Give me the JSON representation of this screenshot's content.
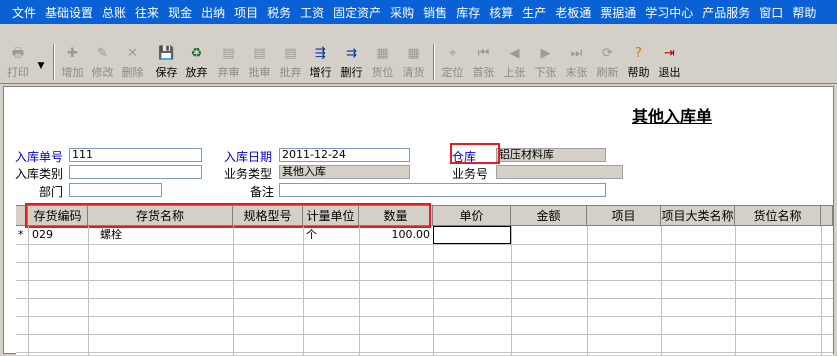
{
  "menu": [
    "文件",
    "基础设置",
    "总账",
    "往来",
    "现金",
    "出纳",
    "项目",
    "税务",
    "工资",
    "固定资产",
    "采购",
    "销售",
    "库存",
    "核算",
    "生产",
    "老板通",
    "票据通",
    "学习中心",
    "产品服务",
    "窗口",
    "帮助"
  ],
  "toolbar": {
    "print": "打印",
    "add": "增加",
    "edit": "修改",
    "delete": "删除",
    "save": "保存",
    "discard": "放弃",
    "abandon_review": "弃审",
    "review": "批审",
    "batch_review": "批弃",
    "add_row": "增行",
    "delete_row": "删行",
    "location": "货位",
    "clear_location": "清货",
    "position": "定位",
    "first": "首张",
    "prev": "上张",
    "next": "下张",
    "last": "末张",
    "refresh": "刷新",
    "help": "帮助",
    "exit": "退出"
  },
  "form": {
    "title": "其他入库单",
    "doc_no_label": "入库单号",
    "doc_no": "111",
    "date_label": "入库日期",
    "date": "2011-12-24",
    "warehouse_label": "仓库",
    "warehouse": "铝压材料库",
    "type_label": "入库类别",
    "type": "",
    "biz_type_label": "业务类型",
    "biz_type": "其他入库",
    "biz_no_label": "业务号",
    "biz_no": "",
    "dept_label": "部门",
    "dept": "",
    "remark_label": "备注",
    "remark": ""
  },
  "grid": {
    "headers": [
      "存货编码",
      "存货名称",
      "规格型号",
      "计量单位",
      "数量",
      "单价",
      "金额",
      "项目",
      "项目大类名称",
      "货位名称"
    ],
    "rows": [
      {
        "marker": "*",
        "code": "029",
        "name": "螺栓",
        "spec": "",
        "unit": "个",
        "qty": "100.00",
        "price": "",
        "amount": "",
        "project": "",
        "project_cat": "",
        "location": ""
      }
    ]
  },
  "colors": {
    "menubar": "#0a61d6",
    "highlight": "#e02020",
    "label_blue": "#0000cc"
  }
}
